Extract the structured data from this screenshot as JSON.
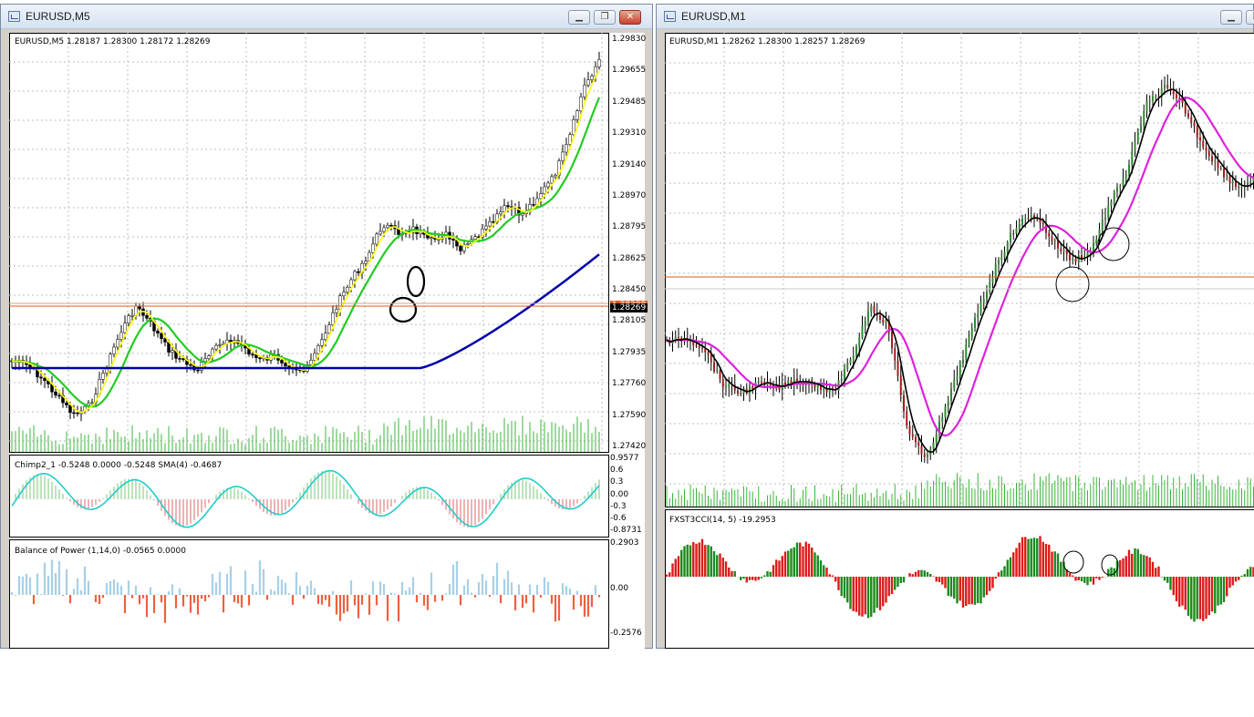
{
  "left_window": {
    "title": "EURUSD,M5",
    "buttons": [
      "minimize",
      "restore",
      "close"
    ],
    "main_panel": {
      "header": "EURUSD,M5  1.28187 1.28300 1.28172 1.28269",
      "price_axis": [
        "1.29830",
        "1.29655",
        "1.29485",
        "1.29310",
        "1.29140",
        "1.28970",
        "1.28795",
        "1.28625",
        "1.28450",
        "1.28105",
        "1.27935",
        "1.27760",
        "1.27590",
        "1.27420"
      ],
      "current_price": "1.28269",
      "ask_price_tag": "1.28300"
    },
    "indicator1": {
      "header": "Chimp2_1 -0.5248 0.0000 -0.5248  SMA(4) -0.4687",
      "axis": [
        "0.9577",
        "0.6",
        "0.3",
        "0.00",
        "-0.3",
        "-0.6",
        "-0.8731"
      ]
    },
    "indicator2": {
      "header": "Balance of Power (1,14,0) -0.0565 0.0000",
      "axis": [
        "0.2903",
        "0.00",
        "-0.2576"
      ]
    },
    "colors": {
      "ma_fast": "#ffff00",
      "ma_mid": "#22cc22",
      "ma_slow": "#0000aa",
      "bop_up": "#a8d0e6",
      "bop_down": "#f06040"
    }
  },
  "right_window": {
    "title": "EURUSD,M1",
    "buttons": [
      "minimize"
    ],
    "main_panel": {
      "header": "EURUSD,M1  1.28262 1.28300 1.28257 1.28269"
    },
    "indicator1": {
      "header": "FXST3CCI(14, 5) -19.2953"
    },
    "colors": {
      "ma_fast": "#000000",
      "ma_slow": "#dd22dd",
      "cci_up": "#1a8a1a",
      "cci_down": "#dd1a1a"
    }
  }
}
